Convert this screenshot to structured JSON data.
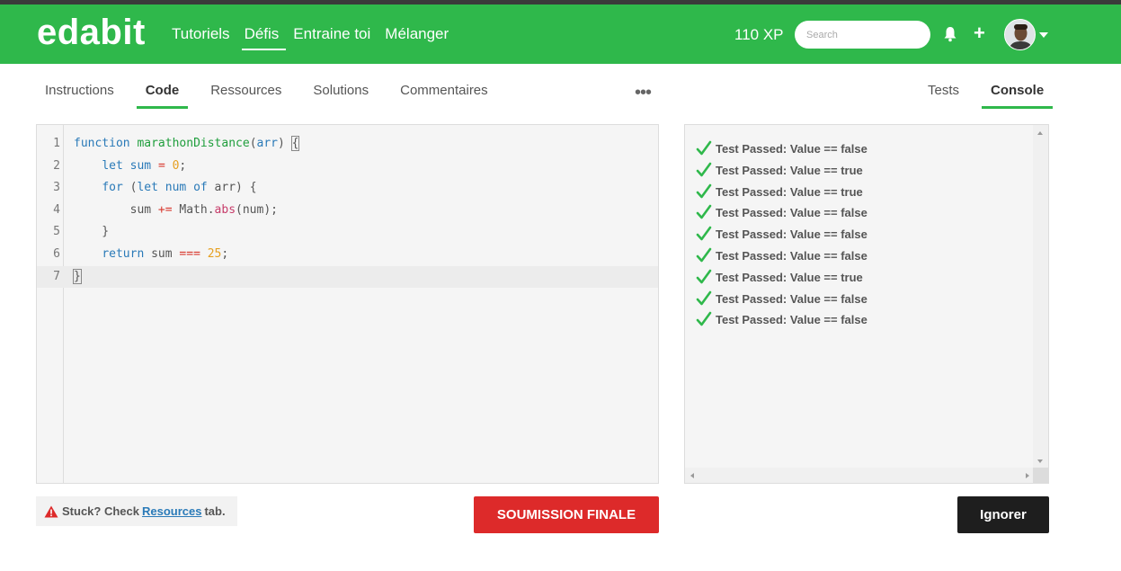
{
  "navbar": {
    "logo": "edabit",
    "links": [
      "Tutoriels",
      "Défis",
      "Entraine toi",
      "Mélanger"
    ],
    "active_link": "Défis",
    "xp": "110 XP",
    "search_placeholder": "Search",
    "plus": "+"
  },
  "left_tabs": [
    "Instructions",
    "Code",
    "Ressources",
    "Solutions",
    "Commentaires"
  ],
  "more": "•••",
  "right_tabs": [
    "Tests",
    "Console"
  ],
  "editor": {
    "line_numbers": [
      "1",
      "2",
      "3",
      "4",
      "5",
      "6",
      "7"
    ]
  },
  "console": {
    "results": [
      "Test Passed: Value == false",
      "Test Passed: Value == true",
      "Test Passed: Value == true",
      "Test Passed: Value == false",
      "Test Passed: Value == false",
      "Test Passed: Value == false",
      "Test Passed: Value == true",
      "Test Passed: Value == false",
      "Test Passed: Value == false"
    ]
  },
  "footer": {
    "stuck_prefix": "Stuck? Check",
    "stuck_link": "Resources",
    "stuck_suffix": "tab.",
    "submit_label": "SOUMISSION FINALE",
    "ignore_label": "Ignorer"
  },
  "colors": {
    "brand_green": "#2fb84b",
    "submit_red": "#dd2a2a",
    "ignore_dark": "#1e1e1e",
    "link_blue": "#2a7ab8"
  }
}
